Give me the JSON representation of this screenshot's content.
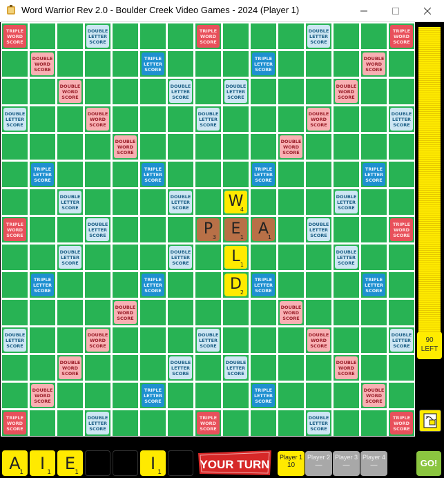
{
  "window": {
    "title": "Word Warrior Rev 2.0 - Boulder Creek Video Games - 2024 (Player 1)",
    "minimize_icon": "minimize-icon",
    "maximize_icon": "maximize-icon",
    "close_icon": "close-icon"
  },
  "board": {
    "size": 15,
    "premium_labels": {
      "TW": [
        "TRIPLE",
        "WORD",
        "SCORE"
      ],
      "DW": [
        "DOUBLE",
        "WORD",
        "SCORE"
      ],
      "TL": [
        "TRIPLE",
        "LETTER",
        "SCORE"
      ],
      "DL": [
        "DOUBLE",
        "LETTER",
        "SCORE"
      ]
    },
    "premium_squares": [
      [
        "TW",
        "",
        "",
        "DL",
        "",
        "",
        "",
        "TW",
        "",
        "",
        "",
        "DL",
        "",
        "",
        "TW"
      ],
      [
        "",
        "DW",
        "",
        "",
        "",
        "TL",
        "",
        "",
        "",
        "TL",
        "",
        "",
        "",
        "DW",
        ""
      ],
      [
        "",
        "",
        "DW",
        "",
        "",
        "",
        "DL",
        "",
        "DL",
        "",
        "",
        "",
        "DW",
        "",
        ""
      ],
      [
        "DL",
        "",
        "",
        "DW",
        "",
        "",
        "",
        "DL",
        "",
        "",
        "",
        "DW",
        "",
        "",
        "DL"
      ],
      [
        "",
        "",
        "",
        "",
        "DW",
        "",
        "",
        "",
        "",
        "",
        "DW",
        "",
        "",
        "",
        ""
      ],
      [
        "",
        "TL",
        "",
        "",
        "",
        "TL",
        "",
        "",
        "",
        "TL",
        "",
        "",
        "",
        "TL",
        ""
      ],
      [
        "",
        "",
        "DL",
        "",
        "",
        "",
        "DL",
        "",
        "DL",
        "",
        "",
        "",
        "DL",
        "",
        ""
      ],
      [
        "TW",
        "",
        "",
        "DL",
        "",
        "",
        "",
        "",
        "",
        "",
        "",
        "DL",
        "",
        "",
        "TW"
      ],
      [
        "",
        "",
        "DL",
        "",
        "",
        "",
        "DL",
        "",
        "DL",
        "",
        "",
        "",
        "DL",
        "",
        ""
      ],
      [
        "",
        "TL",
        "",
        "",
        "",
        "TL",
        "",
        "",
        "",
        "TL",
        "",
        "",
        "",
        "TL",
        ""
      ],
      [
        "",
        "",
        "",
        "",
        "DW",
        "",
        "",
        "",
        "",
        "",
        "DW",
        "",
        "",
        "",
        ""
      ],
      [
        "DL",
        "",
        "",
        "DW",
        "",
        "",
        "",
        "DL",
        "",
        "",
        "",
        "DW",
        "",
        "",
        "DL"
      ],
      [
        "",
        "",
        "DW",
        "",
        "",
        "",
        "DL",
        "",
        "DL",
        "",
        "",
        "",
        "DW",
        "",
        ""
      ],
      [
        "",
        "DW",
        "",
        "",
        "",
        "TL",
        "",
        "",
        "",
        "TL",
        "",
        "",
        "",
        "DW",
        ""
      ],
      [
        "TW",
        "",
        "",
        "DL",
        "",
        "",
        "",
        "TW",
        "",
        "",
        "",
        "DL",
        "",
        "",
        "TW"
      ]
    ],
    "placed_tiles": [
      {
        "row": 6,
        "col": 8,
        "letter": "W",
        "points": "4",
        "style": "normal"
      },
      {
        "row": 7,
        "col": 7,
        "letter": "P",
        "points": "3",
        "style": "bonus"
      },
      {
        "row": 7,
        "col": 8,
        "letter": "E",
        "points": "1",
        "style": "bonus"
      },
      {
        "row": 7,
        "col": 9,
        "letter": "A",
        "points": "1",
        "style": "bonus"
      },
      {
        "row": 8,
        "col": 8,
        "letter": "L",
        "points": "1",
        "style": "normal"
      },
      {
        "row": 9,
        "col": 8,
        "letter": "D",
        "points": "2",
        "style": "normal"
      }
    ]
  },
  "sidebar": {
    "tiles_left_count": "90",
    "tiles_left_label": "LEFT",
    "shuffle_icon": "shuffle-icon"
  },
  "rack": [
    {
      "letter": "A",
      "points": "1"
    },
    {
      "letter": "I",
      "points": "1"
    },
    {
      "letter": "E",
      "points": "1"
    },
    {
      "letter": "",
      "points": ""
    },
    {
      "letter": "",
      "points": ""
    },
    {
      "letter": "I",
      "points": "1"
    },
    {
      "letter": "",
      "points": ""
    }
  ],
  "turn_banner": "YOUR TURN",
  "players": [
    {
      "name": "Player 1",
      "score": "10",
      "active": true
    },
    {
      "name": "Player 2",
      "score": "—",
      "active": false
    },
    {
      "name": "Player 3",
      "score": "—",
      "active": false
    },
    {
      "name": "Player 4",
      "score": "—",
      "active": false
    }
  ],
  "go_button": "GO!",
  "colors": {
    "board_green": "#28b354",
    "triple_word": "#e8505b",
    "double_word": "#f8b0b3",
    "triple_letter": "#1e90d0",
    "double_letter": "#cde6f3",
    "tile_yellow": "#ffea00",
    "tile_bonus_brown": "#b87047",
    "go_green": "#8bc540"
  }
}
